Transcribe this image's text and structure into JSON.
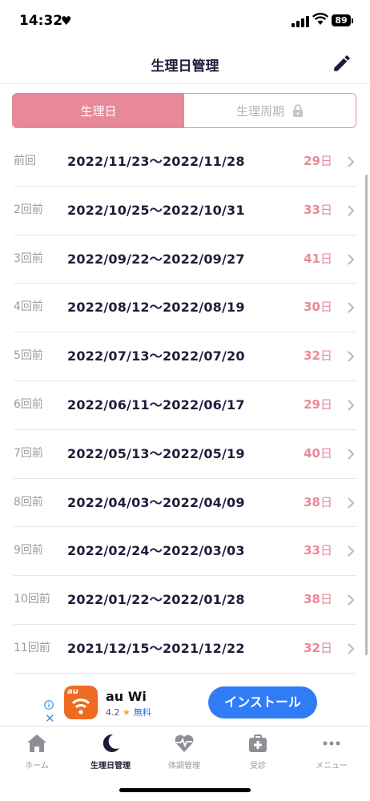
{
  "status_bar": {
    "time": "14:32",
    "battery": "89"
  },
  "header": {
    "title": "生理日管理"
  },
  "segment": {
    "active_label": "生理日",
    "inactive_label": "生理周期"
  },
  "periods": [
    {
      "label": "前回",
      "range": "2022/11/23〜2022/11/28",
      "days": "29",
      "unit": "日"
    },
    {
      "label": "2回前",
      "range": "2022/10/25〜2022/10/31",
      "days": "33",
      "unit": "日"
    },
    {
      "label": "3回前",
      "range": "2022/09/22〜2022/09/27",
      "days": "41",
      "unit": "日"
    },
    {
      "label": "4回前",
      "range": "2022/08/12〜2022/08/19",
      "days": "30",
      "unit": "日"
    },
    {
      "label": "5回前",
      "range": "2022/07/13〜2022/07/20",
      "days": "32",
      "unit": "日"
    },
    {
      "label": "6回前",
      "range": "2022/06/11〜2022/06/17",
      "days": "29",
      "unit": "日"
    },
    {
      "label": "7回前",
      "range": "2022/05/13〜2022/05/19",
      "days": "40",
      "unit": "日"
    },
    {
      "label": "8回前",
      "range": "2022/04/03〜2022/04/09",
      "days": "38",
      "unit": "日"
    },
    {
      "label": "9回前",
      "range": "2022/02/24〜2022/03/03",
      "days": "33",
      "unit": "日"
    },
    {
      "label": "10回前",
      "range": "2022/01/22〜2022/01/28",
      "days": "38",
      "unit": "日"
    },
    {
      "label": "11回前",
      "range": "2021/12/15〜2021/12/22",
      "days": "32",
      "unit": "日"
    }
  ],
  "ad": {
    "app_name": "au Wi",
    "rating": "4.2",
    "price": "無料",
    "install_label": "インストール",
    "app_icon_text": "au"
  },
  "tabs": [
    {
      "label": "ホーム",
      "icon": "home-icon"
    },
    {
      "label": "生理日管理",
      "icon": "moon-icon"
    },
    {
      "label": "体調管理",
      "icon": "heart-pulse-icon"
    },
    {
      "label": "受診",
      "icon": "medical-kit-icon"
    },
    {
      "label": "メニュー",
      "icon": "more-icon"
    }
  ],
  "colors": {
    "accent": "#e8899a",
    "text": "#1d1d3b",
    "install": "#2f7cf6"
  }
}
